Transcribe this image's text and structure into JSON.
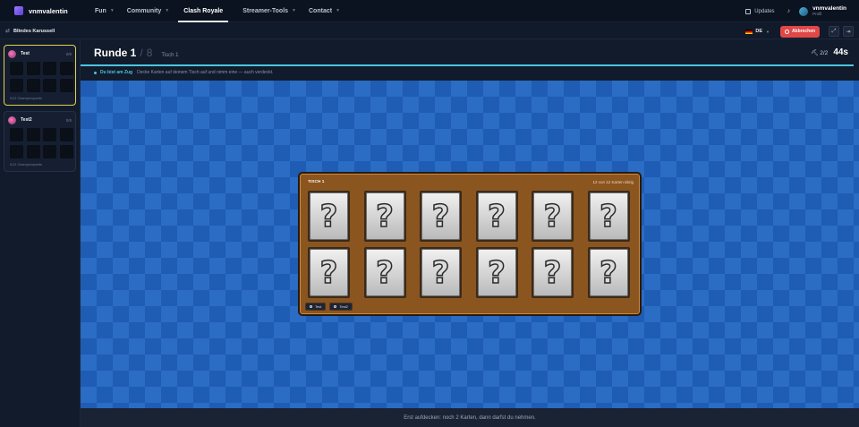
{
  "brand": {
    "name": "vnmvalentin"
  },
  "nav": {
    "items": [
      {
        "label": "Fun",
        "chevron": true
      },
      {
        "label": "Community",
        "chevron": true
      },
      {
        "label": "Clash Royale",
        "chevron": false,
        "active": true
      },
      {
        "label": "Streamer-Tools",
        "chevron": true
      },
      {
        "label": "Contact",
        "chevron": true
      }
    ],
    "updates": "Updates",
    "user": {
      "name": "vnmvalentin",
      "sub": "Profil"
    }
  },
  "subbar": {
    "title": "Blindes Karussell",
    "language": "DE",
    "abort": "Abbrechen"
  },
  "sidebar": {
    "players": [
      {
        "name": "Test",
        "score": "0/8",
        "footer": "0/12 Championpoints",
        "active": true
      },
      {
        "name": "Test2",
        "score": "0/8",
        "footer": "0/12 Championpoints",
        "active": false
      }
    ]
  },
  "header": {
    "round_label": "Runde 1",
    "round_sep": "/",
    "round_total": "8",
    "table_label": "Tisch 1",
    "cards": "2/2",
    "timer": "44s",
    "progress": 1.0,
    "turn_strong": "Du bist am Zug",
    "turn_text": "Decke Karten auf deinem Tisch auf und nimm eine — auch verdeckt."
  },
  "table": {
    "title": "TISCH 1",
    "left": "12 von 12 Karten übrig",
    "cards": [
      "?",
      "?",
      "?",
      "?",
      "?",
      "?",
      "?",
      "?",
      "?",
      "?",
      "?",
      "?"
    ],
    "players": [
      "Test",
      "Test2"
    ]
  },
  "bottom_hint": "Erst aufdecken: noch 2 Karten, dann darfst du nehmen.",
  "colors": {
    "accent": "#4cc4e0",
    "danger": "#e04848",
    "table": "#8b5520",
    "active_border": "#e3cf4f"
  }
}
